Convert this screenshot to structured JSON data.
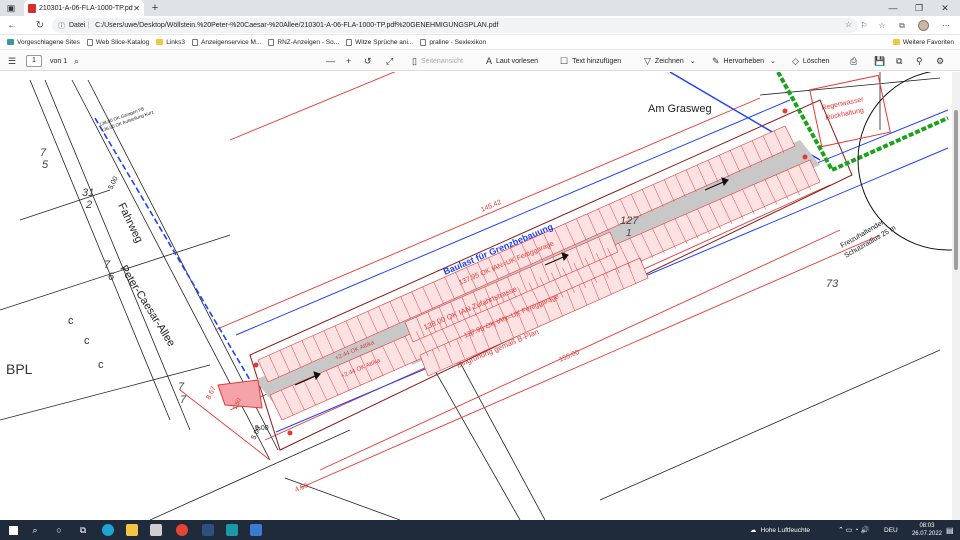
{
  "browser": {
    "tab_title": "210301-A-06-FLA-1000-TP.pdf",
    "address_label": "Datei",
    "url": "C:/Users/uwe/Desktop/Wöllstein.%20Peter-%20Caesar-%20Allee/210301-A-06-FLA-1000-TP.pdf%20GENEHMIGUNGSPLAN.pdf"
  },
  "bookmarks": {
    "items": [
      "Vorgeschlagene Sites",
      "Web Slice-Katalog",
      "Links3",
      "Anzeigenservice M...",
      "RNZ-Anzeigen - So...",
      "Witze Sprüche ani...",
      "praline - Sexlexikon"
    ],
    "other": "Weitere Favoriten"
  },
  "pdf_toolbar": {
    "page_current": "1",
    "page_total": "von 1",
    "page_view": "Seitenansicht",
    "read_aloud": "Laut vorlesen",
    "add_text": "Text hinzufügen",
    "draw": "Zeichnen",
    "highlight": "Hervorheben",
    "erase": "Löschen"
  },
  "plan": {
    "labels": {
      "am_grasweg": "Am Grasweg",
      "fahrweg": "Fahrweg",
      "street": "Peter-Caesar-Allee",
      "baulast": "Baulast für Grenzbebauung",
      "zufahrt": "138.00 OK IAN Zufahrtstrasse",
      "fertiggarage_top": "137.95 OK IAN=UK Fertiggarage",
      "fertiggarage_bottom": "137.95 OK IAN=UK Fertiggarage",
      "gruenung": "Eingrünung gemäß B-Plan",
      "attika_1": "+2.44 OK Attika",
      "attika_2": "+2.44 OK Attika",
      "regenwasser_1": "Regenwasser",
      "regenwasser_2": "Rückhaltung",
      "freizuhalten_1": "Freizuhaltender",
      "freizuhalten_2": "Schutzradius 25 m",
      "lot_127": "127",
      "lot_127_sub": "1",
      "lot_73": "73",
      "lot_7_5_a": "7",
      "lot_7_5_b": "5",
      "lot_31_2_a": "31",
      "lot_31_2_b": "2",
      "lot_7_6_a": "7",
      "lot_7_6_b": "6",
      "lot_7_7_a": "7",
      "lot_7_7_b": "7",
      "bpl": "BPL",
      "c1": "c",
      "c2": "c",
      "c3": "c",
      "dim_145": "145.42",
      "dim_155": "155.00",
      "dim_500_a": "5.00",
      "dim_500_b": "5.00",
      "dim_900": "9.00",
      "dim_456": "4.56",
      "dim_867": "8.67",
      "dim_150": "1.50",
      "gar_1": "138.00 OK Garagen FB",
      "gar_2": "136.00 OK Aufstellung Kurz"
    }
  },
  "taskbar": {
    "weather": "Hohe Luftfeuchte",
    "lang": "DEU",
    "time": "08:03",
    "date": "26.07.2022"
  }
}
